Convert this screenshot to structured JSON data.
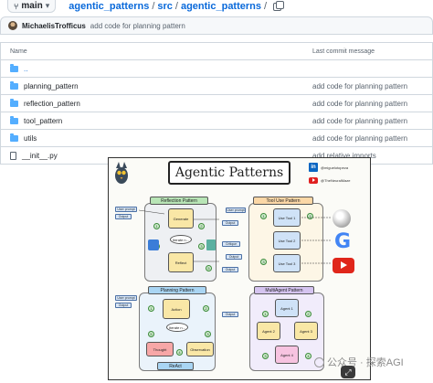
{
  "header": {
    "branch_label": "main",
    "breadcrumb": [
      {
        "label": "agentic_patterns"
      },
      {
        "label": "src"
      },
      {
        "label": "agentic_patterns"
      }
    ],
    "separator": "/"
  },
  "latest_commit": {
    "author": "MichaelisTrofficus",
    "message": "add code for planning pattern"
  },
  "table": {
    "col_name": "Name",
    "col_commit": "Last commit message",
    "rows": [
      {
        "type": "folder",
        "name": "..",
        "commit": ""
      },
      {
        "type": "folder",
        "name": "planning_pattern",
        "commit": "add code for planning pattern"
      },
      {
        "type": "folder",
        "name": "reflection_pattern",
        "commit": "add code for planning pattern"
      },
      {
        "type": "folder",
        "name": "tool_pattern",
        "commit": "add code for planning pattern"
      },
      {
        "type": "folder",
        "name": "utils",
        "commit": "add code for planning pattern"
      },
      {
        "type": "file",
        "name": "__init__.py",
        "commit": "add relative imports"
      }
    ]
  },
  "readme_image": {
    "title": "Agentic Patterns",
    "socials": [
      {
        "icon": "linkedin-icon",
        "handle": "@miguelotopeza"
      },
      {
        "icon": "youtube-icon",
        "handle": "@TheNeuralMaze"
      }
    ],
    "reflection": {
      "title": "Reflection Pattern",
      "user_prompt": "User prompt",
      "generate": "Generate",
      "iterate": "Iterate n...",
      "reflect": "Reflect",
      "output": "Output",
      "critique": "Critique",
      "steps": [
        "1",
        "2",
        "3",
        "4",
        "5"
      ]
    },
    "tool_use": {
      "title": "Tool Use Pattern",
      "user_prompt": "User prompt",
      "tools": [
        "Use Tool 1",
        "Use Tool 2",
        "Use Tool 3"
      ],
      "output": "Output",
      "steps": [
        "1",
        "2",
        "3"
      ]
    },
    "planning": {
      "title": "Planning Pattern",
      "user_prompt": "User prompt",
      "action": "Action",
      "iterate": "Iterate n...",
      "thought": "Thought",
      "observation": "Observation",
      "react": "ReAct",
      "output": "Output",
      "steps": [
        "1",
        "2",
        "3",
        "4",
        "5"
      ]
    },
    "multiagent": {
      "title": "MultiAgent Pattern",
      "agents": [
        "Agent 1",
        "Agent 2",
        "Agent 3",
        "Agent 4"
      ],
      "steps": [
        "1",
        "2",
        "3",
        "4"
      ]
    },
    "watermark": "公众号 · 探索AGI"
  },
  "colors": {
    "link": "#0969da",
    "folder": "#54aeff",
    "muted": "#59636e",
    "border": "#d0d7de",
    "reflection_title_bg": "#b8e5b6",
    "tool_title_bg": "#fbd7a6",
    "planning_title_bg": "#a9d5f3",
    "multiagent_title_bg": "#d5c4f0",
    "wikipedia": "#888888",
    "google": "#4285f4",
    "youtube": "#e0261b"
  }
}
